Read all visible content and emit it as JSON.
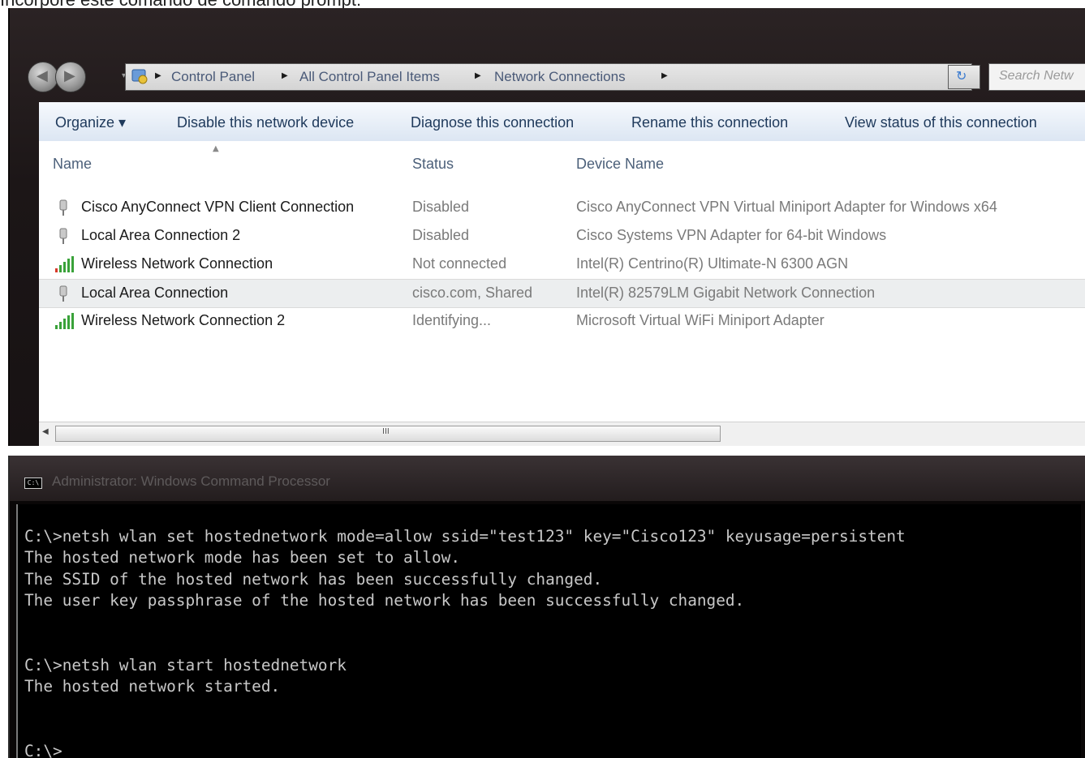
{
  "caption": "Incorpore este comando de comando prompt:",
  "explorer": {
    "breadcrumb": [
      "Control Panel",
      "All Control Panel Items",
      "Network Connections"
    ],
    "search_placeholder": "Search Netw",
    "toolbar": {
      "organize": "Organize ▾",
      "disable": "Disable this network device",
      "diagnose": "Diagnose this connection",
      "rename": "Rename this connection",
      "view_status": "View status of this connection"
    },
    "columns": {
      "name": "Name",
      "status": "Status",
      "device": "Device Name"
    },
    "rows": [
      {
        "name": "Cisco AnyConnect VPN Client Connection",
        "status": "Disabled",
        "device": "Cisco AnyConnect VPN Virtual Miniport Adapter for Windows x64",
        "icon": "network-plug-icon"
      },
      {
        "name": "Local Area Connection 2",
        "status": "Disabled",
        "device": "Cisco Systems VPN Adapter for 64-bit Windows",
        "icon": "network-plug-icon"
      },
      {
        "name": "Wireless Network Connection",
        "status": "Not connected",
        "device": "Intel(R) Centrino(R) Ultimate-N 6300 AGN",
        "icon": "wifi-signal-icon"
      },
      {
        "name": "Local Area Connection",
        "status": "cisco.com, Shared",
        "device": "Intel(R) 82579LM Gigabit Network Connection",
        "icon": "network-plug-icon"
      },
      {
        "name": "Wireless Network Connection 2",
        "status": "Identifying...",
        "device": "Microsoft Virtual WiFi Miniport Adapter",
        "icon": "wifi-signal-icon"
      }
    ],
    "scroll_grip": "III"
  },
  "cmd": {
    "title": "Administrator: Windows Command Processor",
    "icon_text": "C:\\",
    "lines": [
      "C:\\>netsh wlan set hostednetwork mode=allow ssid=\"test123\" key=\"Cisco123\" keyusage=persistent",
      "The hosted network mode has been set to allow.",
      "The SSID of the hosted network has been successfully changed.",
      "The user key passphrase of the hosted network has been successfully changed.",
      "",
      "",
      "C:\\>netsh wlan start hostednetwork",
      "The hosted network started.",
      "",
      "",
      "C:\\>_"
    ]
  },
  "colors": {
    "selected_row": "#eceeef",
    "toolbar_text": "#1e395b",
    "terminal_text": "#c8c8c8",
    "terminal_bg": "#000000"
  }
}
